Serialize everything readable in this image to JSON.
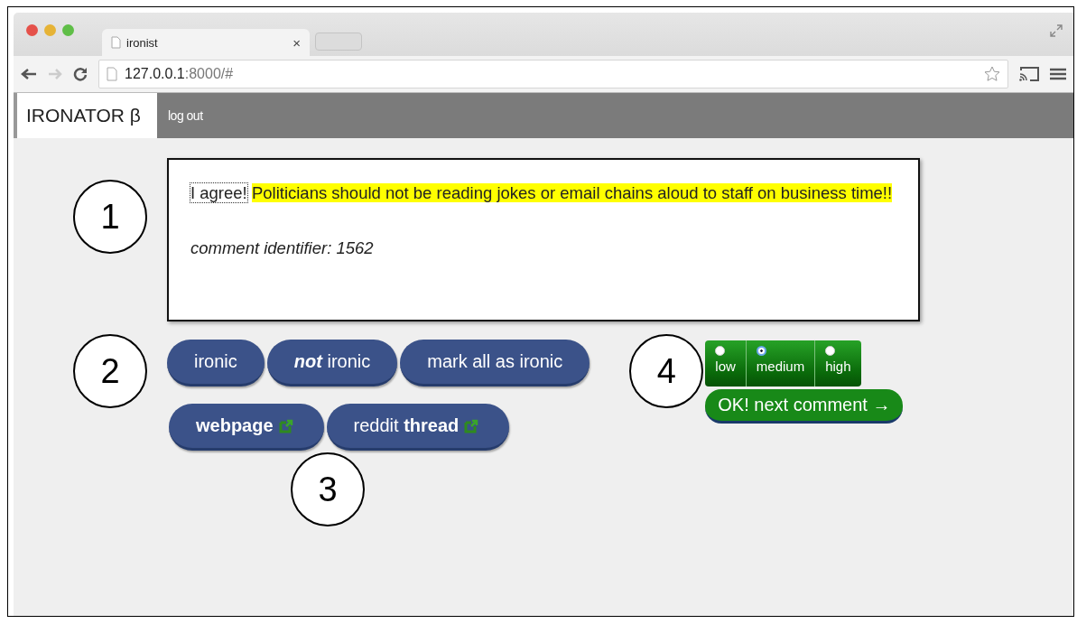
{
  "browser": {
    "tab_title": "ironist",
    "tab_close": "×",
    "url_host": "127.0.0.1",
    "url_rest": ":8000/#"
  },
  "navbar": {
    "brand": "IRONATOR β",
    "logout": "log out"
  },
  "comment": {
    "segments": [
      {
        "text": "I agree!",
        "highlighted": false,
        "focused": true
      },
      {
        "text": "Politicians should not be reading jokes or email chains aloud to staff on business time!!",
        "highlighted": true,
        "focused": false
      }
    ],
    "identifier": "comment identifier: 1562"
  },
  "label_buttons": [
    {
      "label": "ironic",
      "bold": false
    },
    {
      "label": "**not** ironic",
      "bold": false
    },
    {
      "label": "mark all as ironic",
      "bold": false
    }
  ],
  "link_buttons": [
    {
      "label": "webpage",
      "bold": true
    },
    {
      "label": "reddit **thread**",
      "bold": false
    }
  ],
  "confidence": {
    "options": [
      {
        "label": "low",
        "selected": false
      },
      {
        "label": "medium",
        "selected": true
      },
      {
        "label": "high",
        "selected": false
      }
    ],
    "submit": "OK! next comment →"
  },
  "callouts": [
    "1",
    "2",
    "3",
    "4"
  ]
}
